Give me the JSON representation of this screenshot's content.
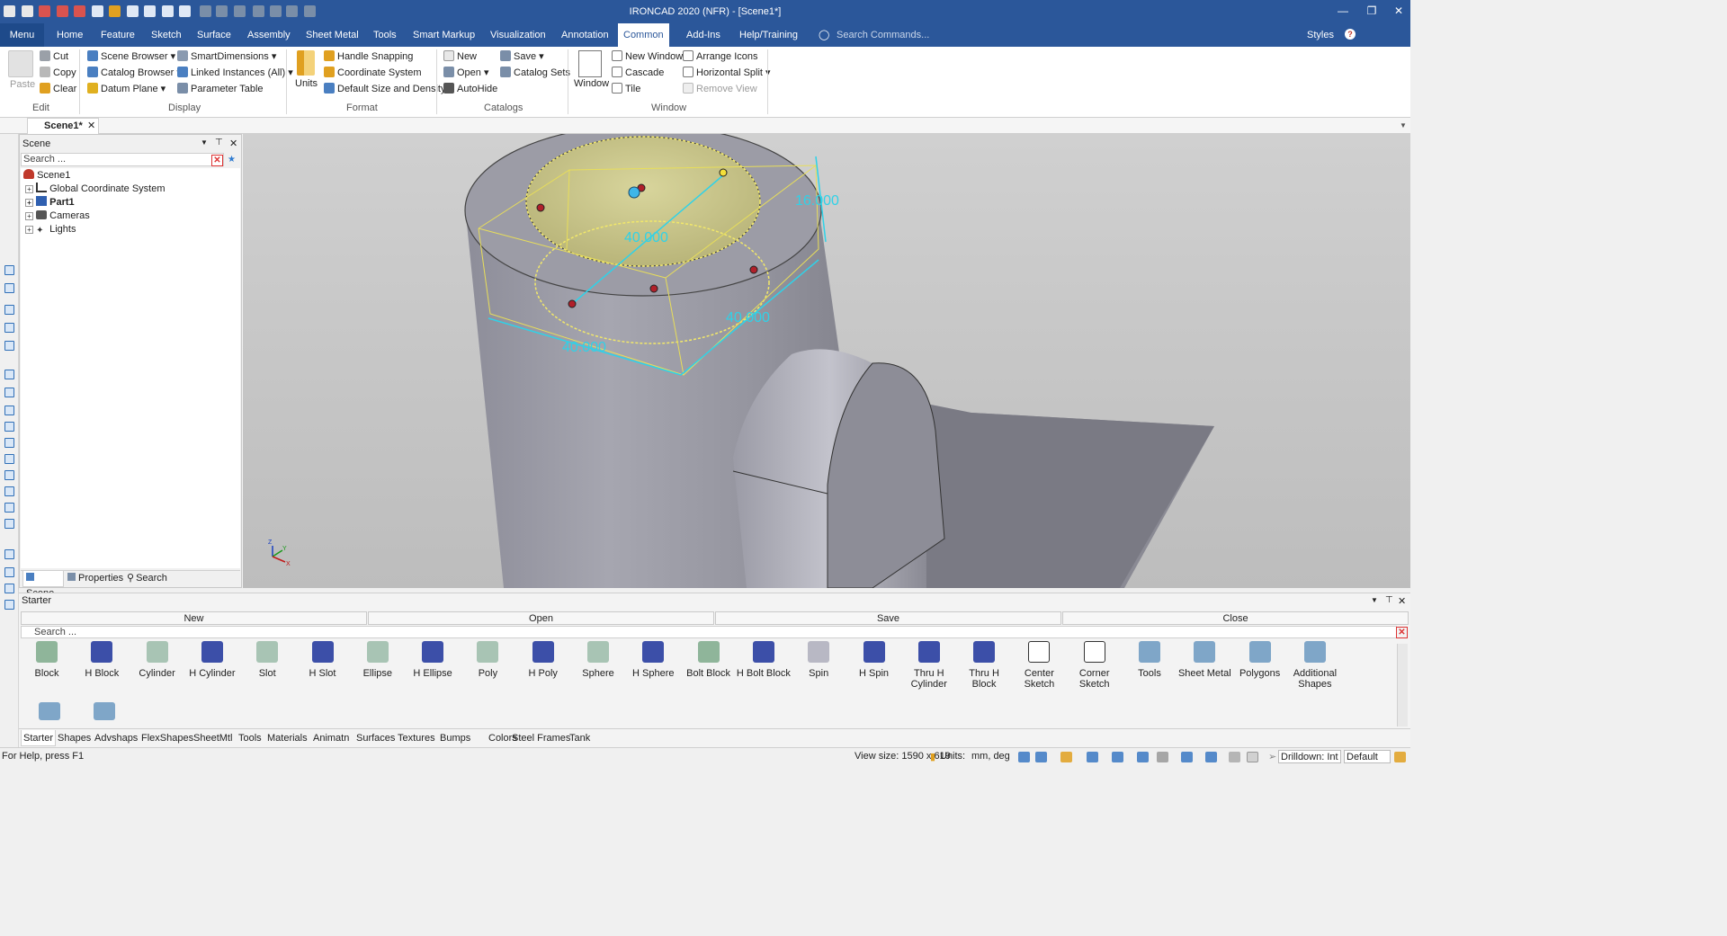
{
  "window": {
    "title": "IRONCAD 2020 (NFR) - [Scene1*]"
  },
  "menu": {
    "menu_label": "Menu",
    "tabs": [
      "Home",
      "Feature",
      "Sketch",
      "Surface",
      "Assembly",
      "Sheet Metal",
      "Tools",
      "Smart Markup",
      "Visualization",
      "Annotation",
      "Common",
      "Add-Ins",
      "Help/Training"
    ],
    "search_placeholder": "Search Commands...",
    "styles_label": "Styles"
  },
  "ribbon": {
    "edit": {
      "paste": "Paste",
      "cut": "Cut",
      "copy": "Copy",
      "clear": "Clear",
      "label": "Edit"
    },
    "display": {
      "scene_browser": "Scene Browser",
      "catalog_browser": "Catalog Browser",
      "datum_plane": "Datum Plane",
      "smart_dimensions": "SmartDimensions",
      "linked_instances": "Linked Instances (All)",
      "parameter_table": "Parameter Table",
      "label": "Display"
    },
    "format": {
      "units": "Units",
      "handle_snapping": "Handle Snapping",
      "coordinate_system": "Coordinate System",
      "default_size": "Default Size and Density",
      "label": "Format"
    },
    "catalogs": {
      "new": "New",
      "open": "Open",
      "autohide": "AutoHide",
      "save": "Save",
      "catalog_sets": "Catalog Sets",
      "label": "Catalogs"
    },
    "window": {
      "window": "Window",
      "new_window": "New Window",
      "cascade": "Cascade",
      "tile": "Tile",
      "arrange_icons": "Arrange Icons",
      "horizontal_split": "Horizontal Split",
      "remove_view": "Remove View",
      "label": "Window"
    }
  },
  "doc_tab": {
    "name": "Scene1*"
  },
  "scene_panel": {
    "title": "Scene",
    "search_placeholder": "Search ...",
    "tree": [
      {
        "label": "Scene1",
        "bold": false
      },
      {
        "label": "Global Coordinate System",
        "bold": false
      },
      {
        "label": "Part1",
        "bold": true
      },
      {
        "label": "Cameras",
        "bold": false
      },
      {
        "label": "Lights",
        "bold": false
      }
    ],
    "bottom_tabs": [
      "Scene",
      "Properties",
      "Search"
    ]
  },
  "viewport": {
    "dims": [
      "40.000",
      "40.000",
      "40.000",
      "16.000"
    ],
    "triad": {
      "z": "Z",
      "y": "Y",
      "x": "X"
    }
  },
  "catalog": {
    "title": "Starter",
    "buttons": [
      "New",
      "Open",
      "Save",
      "Close"
    ],
    "search_placeholder": "Search ...",
    "items": [
      {
        "label": "Block",
        "color": "#8fb59a"
      },
      {
        "label": "H Block",
        "color": "#3c4fa8"
      },
      {
        "label": "Cylinder",
        "color": "#a8c4b4"
      },
      {
        "label": "H Cylinder",
        "color": "#3c4fa8"
      },
      {
        "label": "Slot",
        "color": "#a8c4b4"
      },
      {
        "label": "H Slot",
        "color": "#3c4fa8"
      },
      {
        "label": "Ellipse",
        "color": "#a8c4b4"
      },
      {
        "label": "H Ellipse",
        "color": "#3c4fa8"
      },
      {
        "label": "Poly",
        "color": "#a8c4b4"
      },
      {
        "label": "H Poly",
        "color": "#3c4fa8"
      },
      {
        "label": "Sphere",
        "color": "#a8c4b4"
      },
      {
        "label": "H Sphere",
        "color": "#3c4fa8"
      },
      {
        "label": "Bolt Block",
        "color": "#8fb59a"
      },
      {
        "label": "H Bolt Block",
        "color": "#3c4fa8"
      },
      {
        "label": "Spin",
        "color": "#b8b8c4"
      },
      {
        "label": "H Spin",
        "color": "#3c4fa8"
      },
      {
        "label": "Thru H Cylinder",
        "color": "#3c4fa8"
      },
      {
        "label": "Thru H Block",
        "color": "#3c4fa8"
      },
      {
        "label": "Center Sketch",
        "color": "#ffffff"
      },
      {
        "label": "Corner Sketch",
        "color": "#ffffff"
      },
      {
        "label": "Tools",
        "color": "#7fa6c8"
      },
      {
        "label": "Sheet Metal",
        "color": "#7fa6c8"
      },
      {
        "label": "Polygons",
        "color": "#7fa6c8"
      },
      {
        "label": "Additional Shapes",
        "color": "#7fa6c8"
      }
    ],
    "tabs": [
      "Starter",
      "Shapes",
      "Advshaps",
      "FlexShapes",
      "SheetMtl",
      "Tools",
      "Materials",
      "Animatn",
      "Surfaces",
      "Textures",
      "Bumps",
      "Colors",
      "Steel Frames",
      "Tank"
    ]
  },
  "status": {
    "help": "For Help, press F1",
    "view_size": "View size: 1590 x  619",
    "units_label": "Units:",
    "units_value": "mm, deg",
    "drilldown": "Drilldown: Int",
    "default": "Default"
  }
}
